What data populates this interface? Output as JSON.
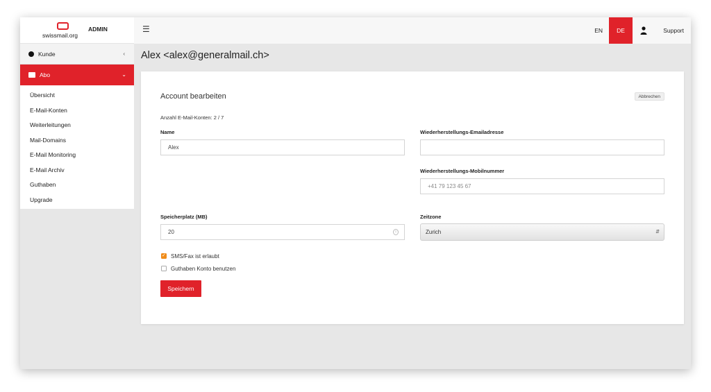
{
  "brand": {
    "logo_text": "swissmail.org",
    "admin_label": "ADMIN"
  },
  "topbar": {
    "lang_en": "EN",
    "lang_de": "DE",
    "support": "Support"
  },
  "sidebar": {
    "kunde": "Kunde",
    "abo": "Abo",
    "items": [
      {
        "label": "Übersicht"
      },
      {
        "label": "E-Mail-Konten"
      },
      {
        "label": "Weiterleitungen"
      },
      {
        "label": "Mail-Domains"
      },
      {
        "label": "E-Mail Monitoring"
      },
      {
        "label": "E-Mail Archiv"
      },
      {
        "label": "Guthaben"
      },
      {
        "label": "Upgrade"
      }
    ]
  },
  "page": {
    "title": "Alex <alex@generalmail.ch>"
  },
  "form": {
    "title": "Account bearbeiten",
    "cancel": "Abbrechen",
    "count": "Anzahl E-Mail-Konten: 2 / 7",
    "name_label": "Name",
    "name_value": "Alex",
    "recovery_email_label": "Wiederherstellungs-Emailadresse",
    "recovery_email_value": "",
    "recovery_mobile_label": "Wiederherstellungs-Mobilnummer",
    "recovery_mobile_placeholder": "+41 79 123 45 67",
    "storage_label": "Speicherplatz (MB)",
    "storage_value": "20",
    "timezone_label": "Zeitzone",
    "timezone_value": "Zurich",
    "sms_label": "SMS/Fax ist erlaubt",
    "sms_checked": true,
    "credit_label": "Guthaben Konto benutzen",
    "credit_checked": false,
    "save": "Speichern"
  },
  "colors": {
    "accent": "#e0222a",
    "checkbox": "#f08c1a"
  },
  "icons": [
    "menu-icon",
    "user-icon",
    "dot-icon",
    "briefcase-icon",
    "chevron-left-icon",
    "chevron-down-icon",
    "spinner-icon",
    "select-arrows-icon"
  ]
}
